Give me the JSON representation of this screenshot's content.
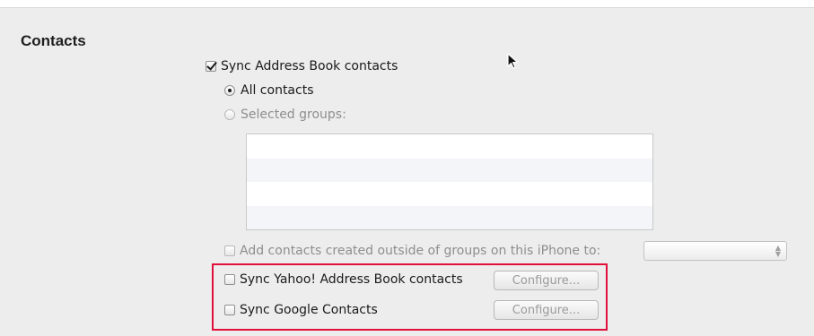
{
  "section": {
    "title": "Contacts"
  },
  "sync_address_book": {
    "label": "Sync Address Book contacts",
    "checked": true
  },
  "all_contacts": {
    "label": "All contacts",
    "selected": true
  },
  "selected_groups": {
    "label": "Selected groups:",
    "selected": false
  },
  "add_outside_groups": {
    "label": "Add contacts created outside of groups on this iPhone to:",
    "checked": false
  },
  "group_select": {
    "value": ""
  },
  "yahoo": {
    "label": "Sync Yahoo! Address Book contacts",
    "checked": false,
    "button_label": "Configure..."
  },
  "google": {
    "label": "Sync Google Contacts",
    "checked": false,
    "button_label": "Configure..."
  },
  "highlight_color": "#e0103a"
}
